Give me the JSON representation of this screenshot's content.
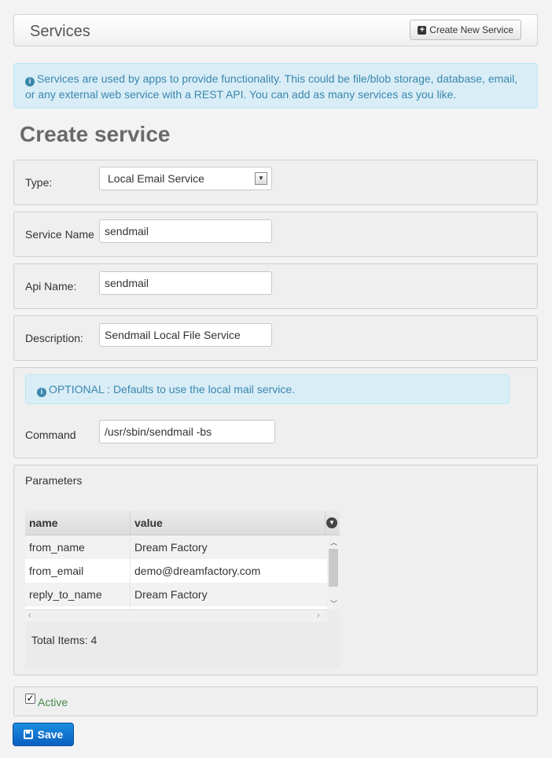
{
  "header": {
    "title": "Services",
    "create_button": "Create New Service"
  },
  "info": {
    "text": "Services are used by apps to provide functionality. This could be file/blob storage, database, email, or any external web service with a REST API. You can add as many services as you like."
  },
  "form": {
    "heading": "Create service",
    "type": {
      "label": "Type:",
      "value": "Local Email Service"
    },
    "service_name": {
      "label": "Service Name",
      "value": "sendmail"
    },
    "api_name": {
      "label": "Api Name:",
      "value": "sendmail"
    },
    "description": {
      "label": "Description:",
      "value": "Sendmail Local File Service"
    },
    "optional_note": "OPTIONAL : Defaults to use the local mail service.",
    "command": {
      "label": "Command",
      "value": "/usr/sbin/sendmail -bs"
    }
  },
  "parameters": {
    "title": "Parameters",
    "columns": [
      "name",
      "value"
    ],
    "rows": [
      {
        "name": "from_name",
        "value": "Dream Factory"
      },
      {
        "name": "from_email",
        "value": "demo@dreamfactory.com"
      },
      {
        "name": "reply_to_name",
        "value": "Dream Factory"
      }
    ],
    "total": "Total Items: 4"
  },
  "active": {
    "label": "Active",
    "checked": true
  },
  "save_label": "Save",
  "colors": {
    "info_bg": "#d9edf7",
    "info_text": "#3a87ad",
    "save_bg": "#0a6fd0",
    "active_text": "#468847"
  }
}
